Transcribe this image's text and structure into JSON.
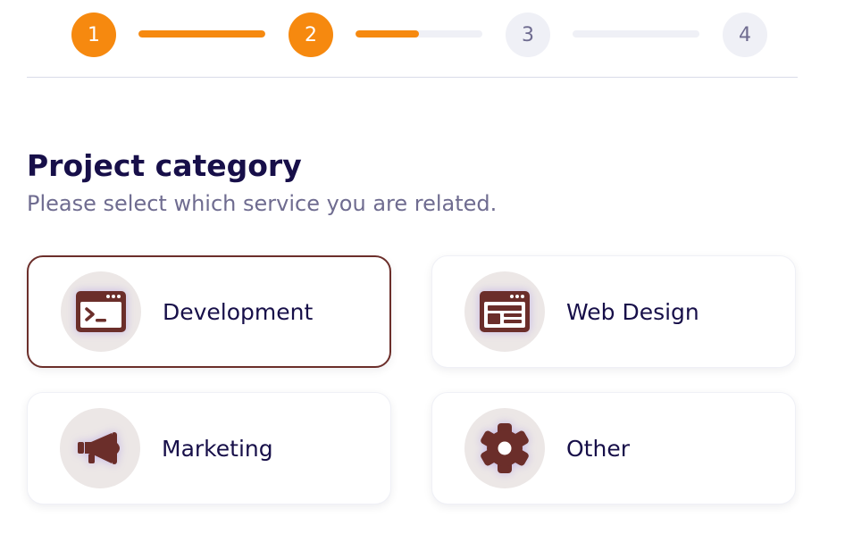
{
  "stepper": {
    "steps": [
      {
        "number": "1",
        "state": "active"
      },
      {
        "number": "2",
        "state": "active"
      },
      {
        "number": "3",
        "state": "inactive"
      },
      {
        "number": "4",
        "state": "inactive"
      }
    ],
    "connector_progress": [
      1.0,
      0.5,
      0.0
    ]
  },
  "header": {
    "title": "Project category",
    "subtitle": "Please select which service you are related."
  },
  "categories": [
    {
      "label": "Development",
      "icon": "terminal-window-icon",
      "selected": true
    },
    {
      "label": "Web Design",
      "icon": "browser-layout-icon",
      "selected": false
    },
    {
      "label": "Marketing",
      "icon": "megaphone-icon",
      "selected": false
    },
    {
      "label": "Other",
      "icon": "gear-icon",
      "selected": false
    }
  ],
  "colors": {
    "accent": "#f6890f",
    "selected_border": "#6b2e2a",
    "icon_color": "#6b2e2a",
    "title": "#170f49",
    "subtitle": "#6f6c90",
    "inactive_step": "#eff0f6"
  }
}
